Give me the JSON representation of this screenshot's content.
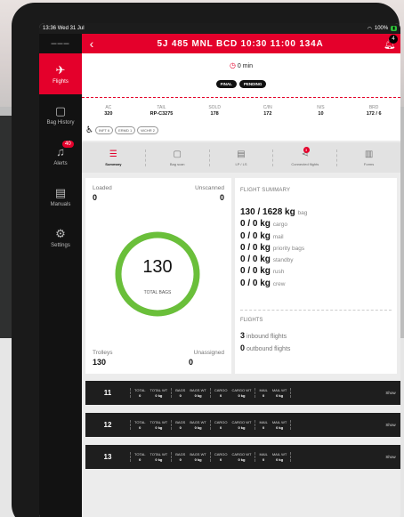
{
  "status_bar": {
    "time": "13:36",
    "date": "Wed 31 Jul",
    "battery": "100%"
  },
  "sidebar": {
    "items": [
      {
        "label": "Flights",
        "icon": "plane-icon",
        "active": true
      },
      {
        "label": "Bag History",
        "icon": "bag-icon"
      },
      {
        "label": "Alerts",
        "icon": "bell-icon",
        "badge": "40"
      },
      {
        "label": "Manuals",
        "icon": "document-icon"
      },
      {
        "label": "Settings",
        "icon": "gear-icon"
      }
    ]
  },
  "header": {
    "title": "5J 485  MNL BCD  10:30 11:00  134A",
    "bell_badge": "4"
  },
  "timer": {
    "text": "0 min",
    "pills": [
      "FINAL",
      "PENDING"
    ]
  },
  "info": {
    "columns": [
      {
        "label": "AC",
        "value": "320"
      },
      {
        "label": "TAIL",
        "value": "RP-C3275"
      },
      {
        "label": "SOLD",
        "value": "178"
      },
      {
        "label": "C/IN",
        "value": "172"
      },
      {
        "label": "N/S",
        "value": "10"
      },
      {
        "label": "BRD",
        "value": "172 / 6"
      }
    ],
    "chips": [
      "INFT  6",
      "ERMD  1",
      "WCHR  2"
    ]
  },
  "tabs": [
    {
      "label": "Summary",
      "icon": "list-icon",
      "active": true
    },
    {
      "label": "Bag scan",
      "icon": "bag-scan-icon"
    },
    {
      "label": "LP / LS",
      "icon": "clipboard-icon"
    },
    {
      "label": "Connected flights",
      "icon": "share-icon",
      "badge": "3"
    },
    {
      "label": "Forms",
      "icon": "forms-icon"
    }
  ],
  "bags": {
    "loaded_label": "Loaded",
    "loaded": "0",
    "unscanned_label": "Unscanned",
    "unscanned": "0",
    "total": "130",
    "total_label": "TOTAL BAGS",
    "trolleys_label": "Trolleys",
    "trolleys": "130",
    "unassigned_label": "Unassigned",
    "unassigned": "0",
    "ring_fraction": 1.0,
    "ring_color": "#6abf3a"
  },
  "summary": {
    "title": "FLIGHT SUMMARY",
    "rows": [
      {
        "value": "130 / 1628 kg",
        "unit": "bag"
      },
      {
        "value": "0 / 0 kg",
        "unit": "cargo"
      },
      {
        "value": "0 / 0 kg",
        "unit": "mail"
      },
      {
        "value": "0 / 0 kg",
        "unit": "priority bags"
      },
      {
        "value": "0 / 0 kg",
        "unit": "standby"
      },
      {
        "value": "0 / 0 kg",
        "unit": "rush"
      },
      {
        "value": "0 / 0 kg",
        "unit": "crew"
      }
    ],
    "flights_title": "FLIGHTS",
    "inbound_count": "3",
    "inbound_label": "inbound flights",
    "outbound_count": "0",
    "outbound_label": "outbound flights"
  },
  "flight_rows": [
    {
      "number": "11",
      "groups": [
        [
          {
            "label": "TOTAL",
            "value": "0"
          },
          {
            "label": "TOTAL WT",
            "value": "0 kg"
          }
        ],
        [
          {
            "label": "BAGS",
            "value": "0"
          },
          {
            "label": "BAGS WT",
            "value": "0 kg"
          }
        ],
        [
          {
            "label": "CARGO",
            "value": "0"
          },
          {
            "label": "CARGO WT",
            "value": "0 kg"
          }
        ],
        [
          {
            "label": "MAIL",
            "value": "0"
          },
          {
            "label": "MAIL WT",
            "value": "0 kg"
          }
        ]
      ],
      "show": "Show"
    },
    {
      "number": "12",
      "groups": [
        [
          {
            "label": "TOTAL",
            "value": "0"
          },
          {
            "label": "TOTAL WT",
            "value": "0 kg"
          }
        ],
        [
          {
            "label": "BAGS",
            "value": "0"
          },
          {
            "label": "BAGS WT",
            "value": "0 kg"
          }
        ],
        [
          {
            "label": "CARGO",
            "value": "0"
          },
          {
            "label": "CARGO WT",
            "value": "0 kg"
          }
        ],
        [
          {
            "label": "MAIL",
            "value": "0"
          },
          {
            "label": "MAIL WT",
            "value": "0 kg"
          }
        ]
      ],
      "show": "Show"
    },
    {
      "number": "13",
      "groups": [
        [
          {
            "label": "TOTAL",
            "value": "0"
          },
          {
            "label": "TOTAL WT",
            "value": "0 kg"
          }
        ],
        [
          {
            "label": "BAGS",
            "value": "0"
          },
          {
            "label": "BAGS WT",
            "value": "0 kg"
          }
        ],
        [
          {
            "label": "CARGO",
            "value": "0"
          },
          {
            "label": "CARGO WT",
            "value": "0 kg"
          }
        ],
        [
          {
            "label": "MAIL",
            "value": "0"
          },
          {
            "label": "MAIL WT",
            "value": "0 kg"
          }
        ]
      ],
      "show": "Show"
    }
  ],
  "colors": {
    "accent": "#e4002b",
    "sidebar_bg": "#121212",
    "row_bg": "#1e1e1e"
  }
}
